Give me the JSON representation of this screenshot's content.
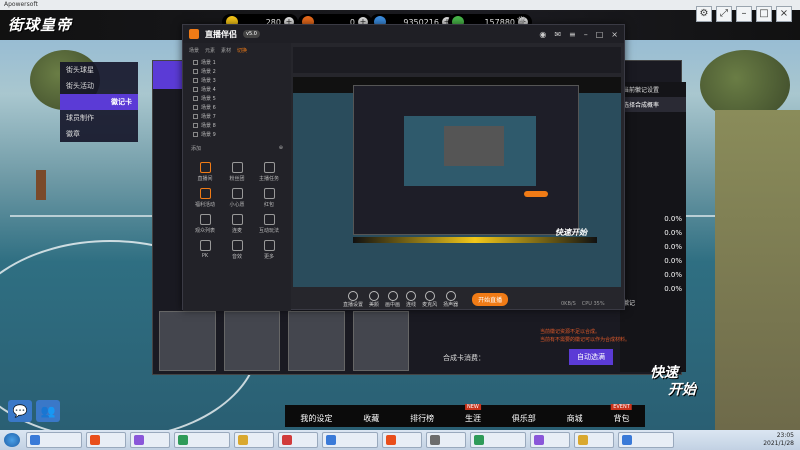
{
  "window": {
    "title": "Apowersoft"
  },
  "game": {
    "logo": "街球皇帝",
    "resources": [
      {
        "value": "280",
        "color": "#f5c518"
      },
      {
        "value": "0",
        "color": "#e86a1c"
      },
      {
        "value": "9350216",
        "color": "#3b8de0"
      },
      {
        "value": "157880",
        "color": "#49b84a"
      }
    ],
    "side_menu": [
      {
        "label": "街头球星",
        "active": false
      },
      {
        "label": "街头活动",
        "active": false
      },
      {
        "label": "徽记卡",
        "active": true
      },
      {
        "label": "球员制作",
        "active": false
      },
      {
        "label": "徽章",
        "active": false
      }
    ],
    "right_panel": {
      "title": "当前徽记设置",
      "subtitle": "选择合成概率",
      "percents": [
        "0.0%",
        "0.0%",
        "0.0%",
        "0.0%",
        "0.0%",
        "0.0%"
      ],
      "notes": "徽记",
      "warning": "当前徽记资源不足以合成。",
      "warning2": "当前有不需要的徽记可以作为合成材料。"
    },
    "compose_label": "合成卡消费：",
    "auto_select": "自动选满",
    "compose_btn": "合成",
    "bottom_nav": [
      {
        "label": "我的设定",
        "badge": ""
      },
      {
        "label": "收藏",
        "badge": ""
      },
      {
        "label": "排行榜",
        "badge": ""
      },
      {
        "label": "生涯",
        "badge": "NEW"
      },
      {
        "label": "俱乐部",
        "badge": ""
      },
      {
        "label": "商城",
        "badge": ""
      },
      {
        "label": "背包",
        "badge": "EVENT"
      }
    ],
    "quick_start": [
      "快速",
      "开始"
    ]
  },
  "stream": {
    "app_name": "直播伴侣",
    "version": "v5.0",
    "tabs": [
      "场景",
      "元素",
      "素材",
      "切换"
    ],
    "scenes": [
      "场景 1",
      "场景 2",
      "场景 3",
      "场景 4",
      "场景 5",
      "场景 6",
      "场景 7",
      "场景 8",
      "场景 9"
    ],
    "add_label": "添加",
    "tools": [
      "直播间",
      "粉丝团",
      "主播任务",
      "福利活动",
      "小心愿",
      "红包",
      "观众列表",
      "连麦",
      "互动玩法",
      "PK",
      "音效",
      "更多"
    ],
    "bottom_tools": [
      "直播设置",
      "美颜",
      "画中画",
      "连线",
      "麦克风",
      "扬声器"
    ],
    "start_live": "开始直播",
    "stats": [
      "0KB/S",
      "CPU 35%"
    ]
  },
  "taskbar": {
    "items": [
      "",
      "",
      "",
      "",
      "",
      "",
      "",
      "",
      "",
      "",
      "",
      "",
      ""
    ],
    "colors": [
      "#3a7ad8",
      "#e94e1b",
      "#8a56d9",
      "#2f9b59",
      "#d9a82f",
      "#d13b3b",
      "#3a7ad8",
      "#e94e1b",
      "#6c6c6c",
      "#2f9b59",
      "#8a56d9",
      "#d9a82f",
      "#3a7ad8"
    ],
    "time": "23:05",
    "date": "2021/1/28"
  }
}
